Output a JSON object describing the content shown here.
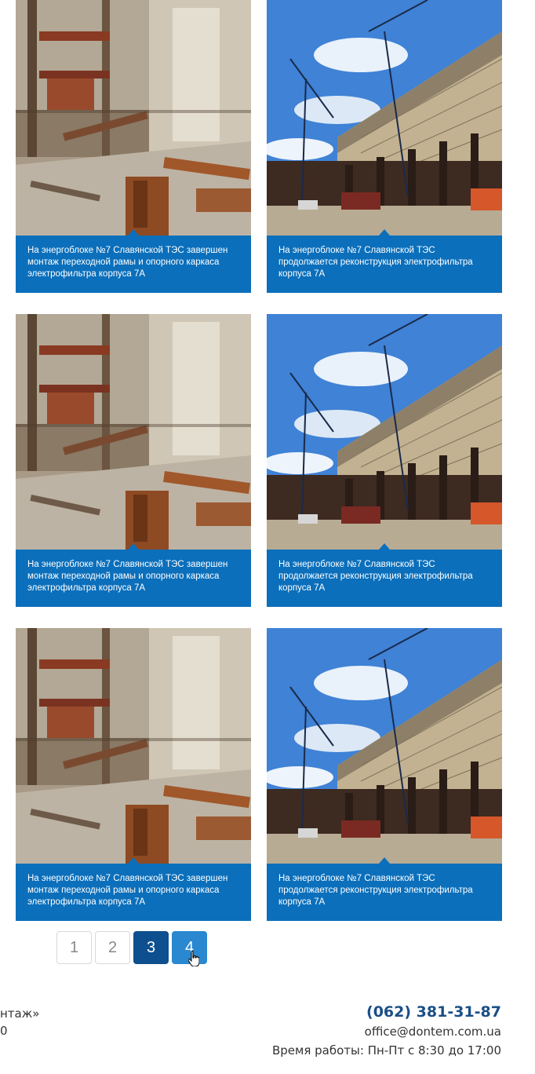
{
  "news": [
    {
      "caption": "На энергоблоке №7 Славянской ТЭС завершен монтаж переходной рамы и опорного каркаса электрофильтра корпуса 7А",
      "photo": "demolition-photo"
    },
    {
      "caption": "На энергоблоке №7 Славянской ТЭС продолжается реконструкция электрофильтра корпуса 7А",
      "photo": "crane-photo"
    },
    {
      "caption": "На энергоблоке №7 Славянской ТЭС завершен монтаж переходной рамы и опорного каркаса электрофильтра корпуса 7А",
      "photo": "demolition-photo"
    },
    {
      "caption": "На энергоблоке №7 Славянской ТЭС продолжается реконструкция электрофильтра корпуса 7А",
      "photo": "crane-photo"
    },
    {
      "caption": "На энергоблоке №7 Славянской ТЭС завершен монтаж переходной рамы и опорного каркаса электрофильтра корпуса 7А",
      "photo": "demolition-photo"
    },
    {
      "caption": "На энергоблоке №7 Славянской ТЭС продолжается реконструкция электрофильтра корпуса 7А",
      "photo": "crane-photo"
    }
  ],
  "pagination": {
    "pages": [
      "1",
      "2",
      "3",
      "4"
    ],
    "current": "3",
    "hovered": "4"
  },
  "footer": {
    "left_line1": "нтаж»",
    "left_line2": "0",
    "phone": "(062) 381-31-87",
    "email": "office@dontem.com.ua",
    "hours": "Время работы: Пн-Пт с 8:30 до 17:00"
  },
  "colors": {
    "card_blue": "#0b6fbb",
    "page_active": "#0e4f8f",
    "page_hover": "#2a88d0",
    "phone": "#1a4f86"
  }
}
